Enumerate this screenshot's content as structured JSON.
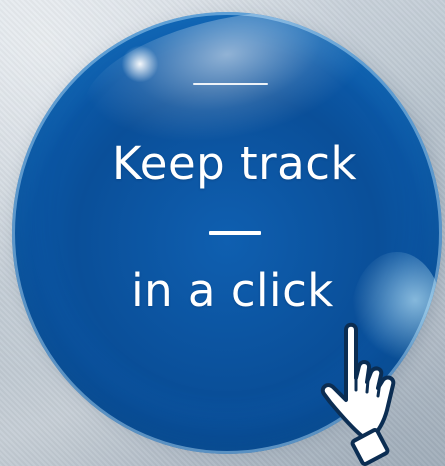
{
  "banner": {
    "line1": "Keep track",
    "line2": "in a click"
  },
  "icons": {
    "pointer": "hand-pointer-icon"
  },
  "colors": {
    "disc": "#0b57a5",
    "disc_rim": "#56aee9",
    "text": "#ffffff",
    "background": "#c3ccd5"
  }
}
